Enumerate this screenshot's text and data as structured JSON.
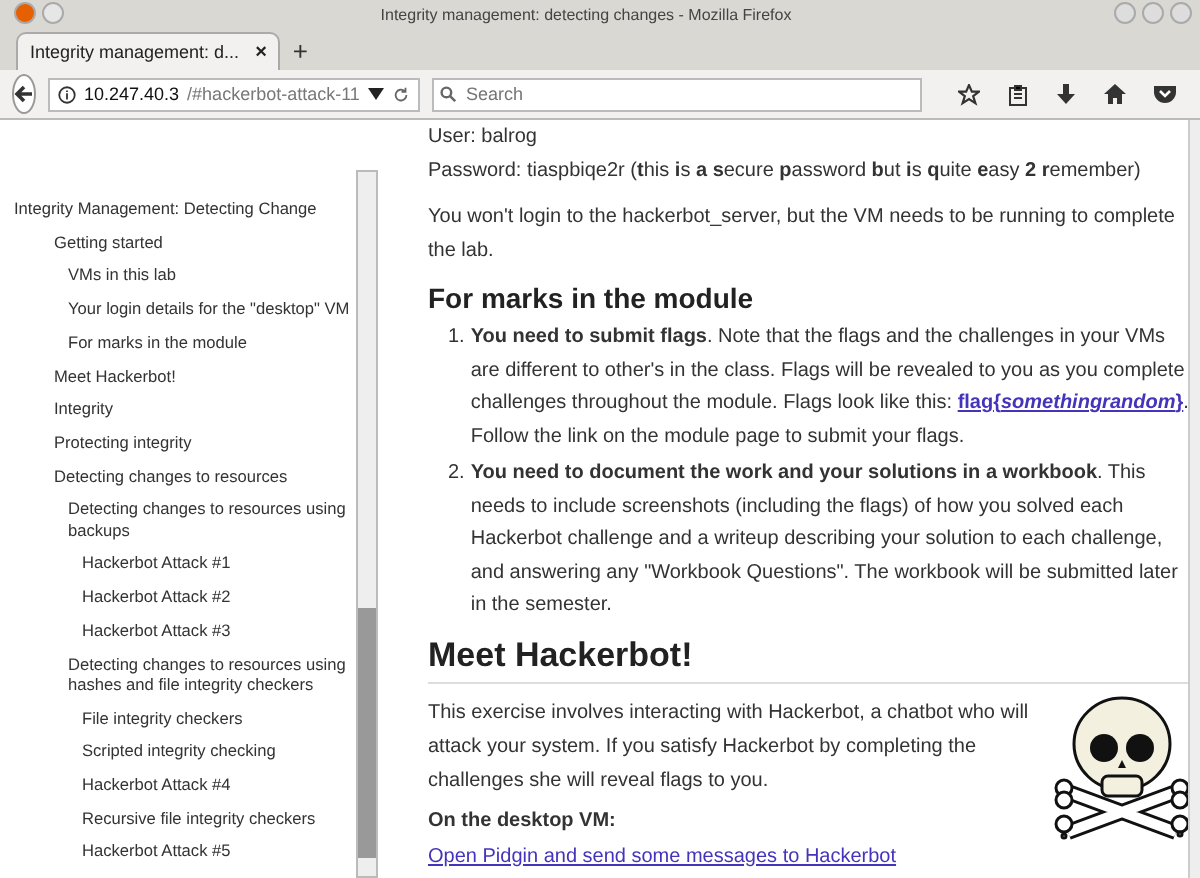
{
  "window": {
    "title": "Integrity management: detecting changes - Mozilla Firefox"
  },
  "tabs": [
    {
      "label": "Integrity management: d...",
      "selected": true,
      "close": "×"
    }
  ],
  "new_tab": "+",
  "address_bar": {
    "host": "10.247.40.3",
    "path": "/#hackerbot-attack-11"
  },
  "search": {
    "placeholder": "Search"
  },
  "sidebar": {
    "items": [
      {
        "label": "Integrity Management: Detecting Change",
        "children": [
          {
            "label": "Getting started",
            "children": [
              {
                "label": "VMs in this lab"
              },
              {
                "label": "Your login details for the \"desktop\" VM"
              },
              {
                "label": "For marks in the module"
              }
            ]
          },
          {
            "label": "Meet Hackerbot!"
          },
          {
            "label": "Integrity"
          },
          {
            "label": "Protecting integrity"
          },
          {
            "label": "Detecting changes to resources",
            "children": [
              {
                "label": "Detecting changes to resources using backups",
                "children": [
                  {
                    "label": "Hackerbot Attack #1"
                  },
                  {
                    "label": "Hackerbot Attack #2"
                  },
                  {
                    "label": "Hackerbot Attack #3"
                  }
                ]
              },
              {
                "label": "Detecting changes to resources using hashes and file integrity checkers",
                "children": [
                  {
                    "label": "File integrity checkers"
                  },
                  {
                    "label": "Scripted integrity checking"
                  },
                  {
                    "label": "Hackerbot Attack #4"
                  },
                  {
                    "label": "Recursive file integrity checkers"
                  },
                  {
                    "label": "Hackerbot Attack #5"
                  }
                ]
              }
            ]
          }
        ]
      }
    ]
  },
  "content": {
    "user_line": "User: balrog",
    "password_line": "Password: tiaspbiqe2r (**t**his **i**s **a** **s**ecure **p**assword **b**ut **i**s **q**uite **e**asy **2** **r**emember)",
    "intro": "You won't login to the hackerbot_server, but the VM needs to be running to complete the lab.",
    "marks_heading": "For marks in the module",
    "marks_list": [
      {
        "number": "1.",
        "lead": "You need to submit flags",
        "text": ". Note that the flags and the challenges in your VMs are different to other's in the class. Flags will be revealed to you as you complete challenges throughout the module. Flags look like this: ",
        "link": "flag{*somethingrandom*}",
        "after": ". Follow the link on the module page to submit your flags."
      },
      {
        "number": "2.",
        "lead": "You need to document the work and your solutions in a workbook",
        "text": ". This needs to include screenshots (including the flags) of how you solved each Hackerbot challenge and a writeup describing your solution to each challenge, and answering any \"Workbook Questions\". The workbook will be submitted later in the semester."
      }
    ],
    "hackerbot_heading": "Meet Hackerbot!",
    "hackerbot_text": "This exercise involves interacting with Hackerbot, a chatbot who will attack your system. If you satisfy Hackerbot by completing the challenges she will reveal flags to you.",
    "desktop_heading": "On the desktop VM:",
    "pidgin_link": "Open Pidgin and send some messages to Hackerbot"
  }
}
